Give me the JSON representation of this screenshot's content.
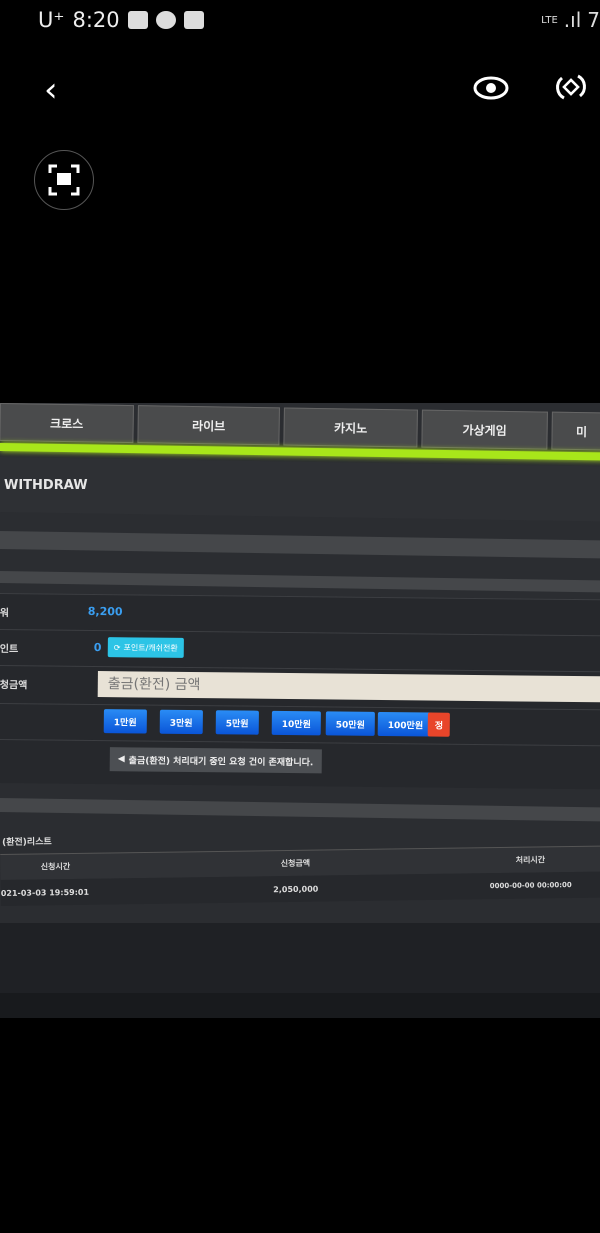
{
  "status_bar": {
    "carrier": "U⁺",
    "time": "8:20",
    "network": "LTE",
    "battery": "7"
  },
  "viewer": {
    "icons": [
      "back-icon",
      "eye-icon",
      "rotate-icon",
      "scan-image-icon"
    ]
  },
  "site": {
    "tabs": [
      "크로스",
      "라이브",
      "카지노",
      "가상게임",
      "미"
    ],
    "accent": "#a8e61a",
    "section_title": "WITHDRAW",
    "form": {
      "balance_label": "워",
      "balance_value": "8,200",
      "point_label": "인트",
      "point_value": "0",
      "convert_button": "포인트/캐쉬전환",
      "amount_label": "청금액",
      "amount_placeholder": "출금(환전) 금액",
      "amount_buttons": [
        "1만원",
        "3만원",
        "5만원",
        "10만원",
        "50만원",
        "100만원"
      ],
      "reset_button": "정",
      "notice": "출금(환전) 처리대기 중인 요청 건이 존재합니다."
    },
    "list": {
      "title": "(환전)리스트",
      "columns": [
        "신청시간",
        "신청금액",
        "처리시간"
      ],
      "rows": [
        {
          "requested": "021-03-03 19:59:01",
          "amount": "2,050,000",
          "processed": "0000-00-00 00:00:00"
        }
      ]
    }
  }
}
